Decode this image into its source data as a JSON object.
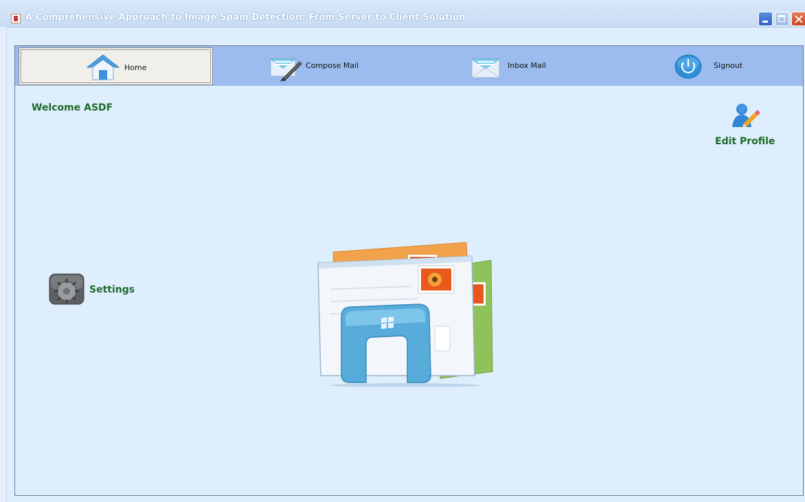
{
  "window": {
    "title": "A Comprehensive Approach to Image Spam Detection: From Server to Client Solution"
  },
  "nav": {
    "tabs": [
      {
        "label": "Home",
        "icon": "home-icon",
        "active": true
      },
      {
        "label": "Compose Mail",
        "icon": "compose-mail-icon",
        "active": false
      },
      {
        "label": "Inbox Mail",
        "icon": "inbox-mail-icon",
        "active": false
      },
      {
        "label": "Signout",
        "icon": "power-icon",
        "active": false
      }
    ]
  },
  "main": {
    "welcome": "Welcome ASDF",
    "edit_profile": "Edit Profile",
    "settings": "Settings",
    "hero_icon": "windows-live-mail-icon"
  },
  "colors": {
    "background": "#dfeefc",
    "menubar": "#9cbcf0",
    "label_green": "#1c6b2a"
  }
}
